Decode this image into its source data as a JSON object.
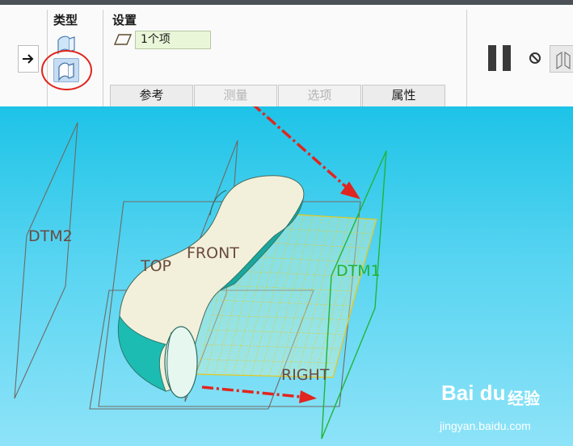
{
  "ribbon": {
    "type_label": "类型",
    "settings_label": "设置",
    "item_value": "1个项",
    "tabs": [
      {
        "label": "参考",
        "enabled": true
      },
      {
        "label": "测量",
        "enabled": false
      },
      {
        "label": "选项",
        "enabled": false
      },
      {
        "label": "属性",
        "enabled": true
      }
    ],
    "icons": {
      "arrow": "arrow-right-icon",
      "type_a": "surface-icon",
      "type_b": "surface-boundary-icon",
      "settings": "parallelogram-plane-icon",
      "pause": "pause-icon",
      "cancel": "no-entry-icon",
      "preview": "preview-icon"
    }
  },
  "viewport": {
    "labels": {
      "dtm2": "DTM2",
      "dtm1": "DTM1",
      "top": "TOP",
      "front": "FRONT",
      "right": "RIGHT"
    },
    "colors": {
      "dtm1": "#1fb535",
      "datum_label": "#6b4a40",
      "annotation": "#e0261e",
      "grid": "#e8c81a",
      "surface": "#f2f0da",
      "surface_inner": "#1dbcb2"
    }
  },
  "watermark": {
    "brand": "Bai du",
    "cn": "经验",
    "url": "jingyan.baidu.com"
  }
}
